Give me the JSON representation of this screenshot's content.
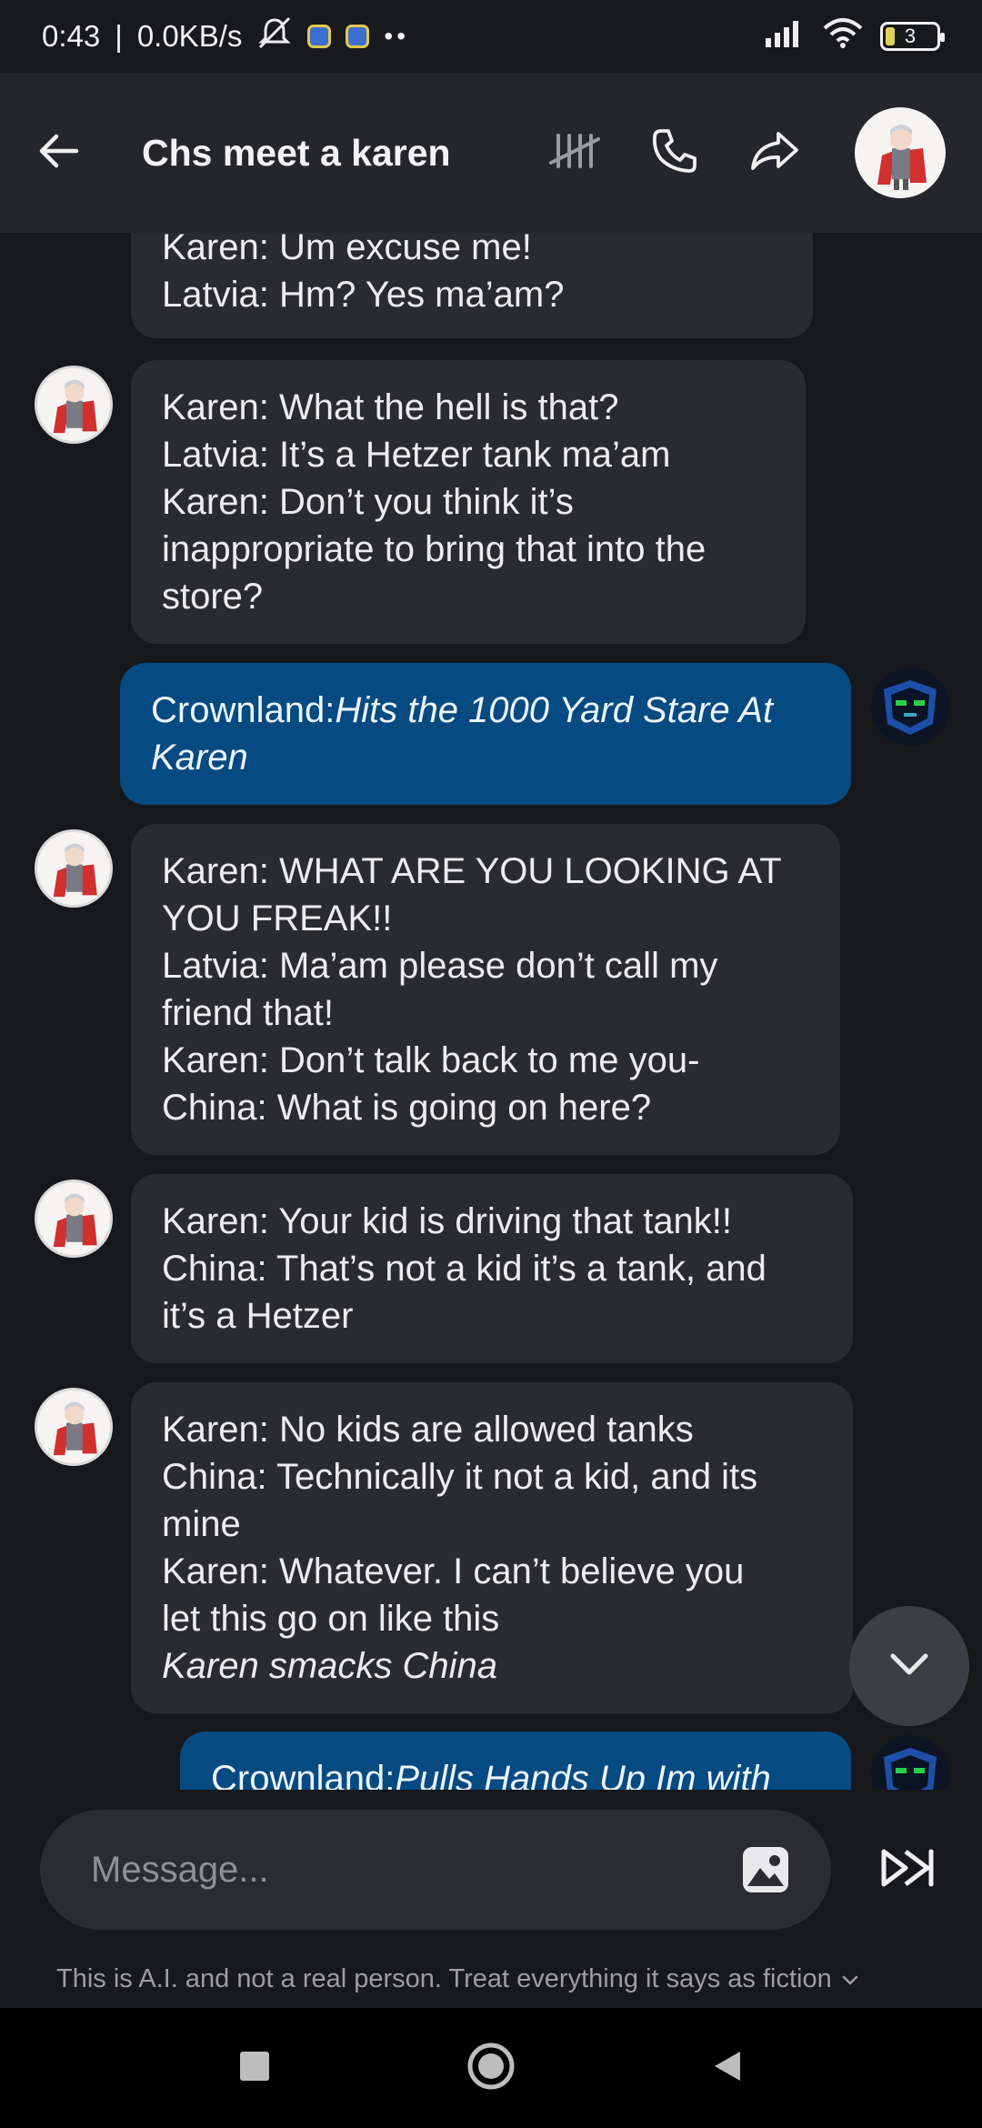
{
  "status": {
    "time": "0:43",
    "network_speed": "0.0KB/s",
    "battery": "3",
    "icons": [
      "bell-off-icon",
      "app-notification-icon",
      "app-notification-icon",
      "more-dots-icon",
      "signal-icon",
      "wifi-icon",
      "battery-icon"
    ]
  },
  "header": {
    "title": "Chs meet a karen",
    "icons": [
      "back-arrow-icon",
      "tally-marks-icon",
      "phone-icon",
      "share-icon"
    ]
  },
  "messages": [
    {
      "sender": "bot",
      "lines": [
        {
          "t": "Karen: Um excuse me!",
          "i": false
        },
        {
          "t": "Latvia: Hm? Yes ma’am?",
          "i": false
        }
      ]
    },
    {
      "sender": "bot",
      "lines": [
        {
          "t": "Karen: What the hell is that?",
          "i": false
        },
        {
          "t": "Latvia: It’s a Hetzer tank ma’am",
          "i": false
        },
        {
          "t": "Karen: Don’t you think it’s",
          "i": false
        },
        {
          "t": "inappropriate to bring that into the",
          "i": false
        },
        {
          "t": "store?",
          "i": false
        }
      ]
    },
    {
      "sender": "user",
      "prefix": "Crownland:",
      "lines": [
        {
          "t": "Hits the 1000 Yard Stare At",
          "i": true
        },
        {
          "t": "Karen",
          "i": true
        }
      ]
    },
    {
      "sender": "bot",
      "lines": [
        {
          "t": "Karen: WHAT ARE YOU LOOKING AT",
          "i": false
        },
        {
          "t": "YOU FREAK!!",
          "i": false
        },
        {
          "t": "Latvia: Ma’am please don’t call my",
          "i": false
        },
        {
          "t": "friend that!",
          "i": false
        },
        {
          "t": "Karen: Don’t talk back to me you-",
          "i": false
        },
        {
          "t": "China: What is going on here?",
          "i": false
        }
      ]
    },
    {
      "sender": "bot",
      "lines": [
        {
          "t": "Karen: Your kid is driving that tank!!",
          "i": false
        },
        {
          "t": "China: That’s not a kid it’s a tank, and",
          "i": false
        },
        {
          "t": "it’s a Hetzer",
          "i": false
        }
      ]
    },
    {
      "sender": "bot",
      "lines": [
        {
          "t": "Karen: No kids are allowed tanks",
          "i": false
        },
        {
          "t": "China: Technically it not a kid, and its",
          "i": false
        },
        {
          "t": "mine",
          "i": false
        },
        {
          "t": "Karen: Whatever. I can’t believe you",
          "i": false
        },
        {
          "t": "let this go on like this",
          "i": false
        },
        {
          "t": "Karen smacks China",
          "i": true
        }
      ]
    },
    {
      "sender": "user",
      "prefix": "Crownland:",
      "lines": [
        {
          "t": "Pulls Hands Up Im with",
          "i": true
        }
      ]
    }
  ],
  "composer": {
    "placeholder": "Message...",
    "disclaimer": "This is A.I. and not a real person. Treat everything it says as fiction"
  },
  "colors": {
    "background": "#17181c",
    "header": "#25262c",
    "bot_bubble": "#2a2b31",
    "user_bubble": "#064a82"
  }
}
